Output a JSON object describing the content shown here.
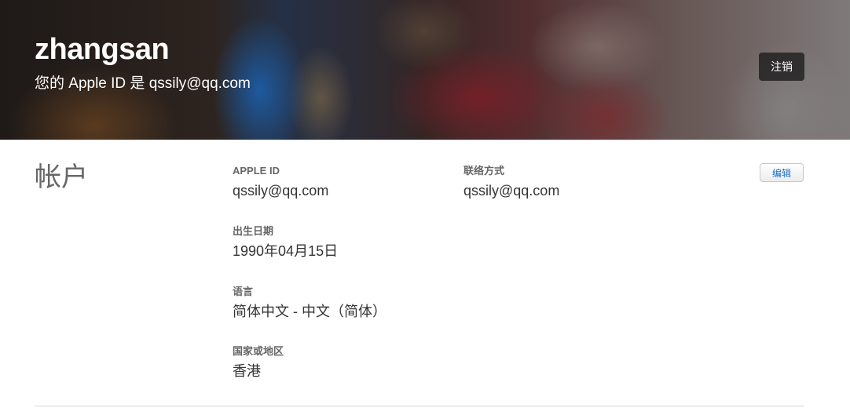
{
  "header": {
    "username": "zhangsan",
    "apple_id_line": "您的 Apple ID 是 qssily@qq.com",
    "logout_label": "注销"
  },
  "account": {
    "section_title": "帐户",
    "edit_label": "编辑",
    "apple_id": {
      "label": "APPLE ID",
      "value": "qssily@qq.com"
    },
    "contact": {
      "label": "联络方式",
      "value": "qssily@qq.com"
    },
    "birthday": {
      "label": "出生日期",
      "value": "1990年04月15日"
    },
    "language": {
      "label": "语言",
      "value": "简体中文 - 中文（简体）"
    },
    "region": {
      "label": "国家或地区",
      "value": "香港"
    }
  }
}
